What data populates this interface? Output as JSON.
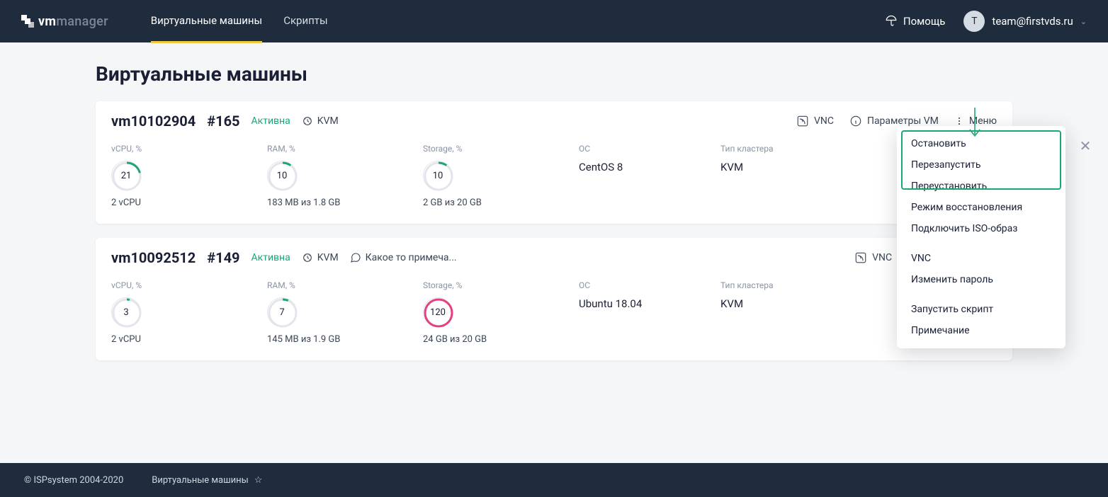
{
  "header": {
    "logo": {
      "prefix": "vm",
      "suffix": "manager"
    },
    "nav": {
      "vm": "Виртуальные машины",
      "scripts": "Скрипты"
    },
    "help": "Помощь",
    "user": {
      "initial": "T",
      "email": "team@firstvds.ru"
    }
  },
  "page": {
    "title": "Виртуальные машины"
  },
  "actions": {
    "vnc": "VNC",
    "params": "Параметры VM",
    "menu": "Меню"
  },
  "labels": {
    "vcpu": "vCPU, %",
    "ram": "RAM, %",
    "storage": "Storage, %",
    "os": "OC",
    "cluster": "Тип кластера"
  },
  "vms": [
    {
      "name": "vm10102904",
      "id": "#165",
      "status": "Активна",
      "hv": "KVM",
      "note": "",
      "vcpu": {
        "pct": "21",
        "sub": "2 vCPU"
      },
      "ram": {
        "pct": "10",
        "sub": "183 MB из 1.8 GB"
      },
      "storage": {
        "pct": "10",
        "sub": "2 GB из 20 GB",
        "hot": false
      },
      "os": "CentOS 8",
      "cluster": "KVM"
    },
    {
      "name": "vm10092512",
      "id": "#149",
      "status": "Активна",
      "hv": "KVM",
      "note": "Какое то примеча...",
      "vcpu": {
        "pct": "3",
        "sub": "2 vCPU"
      },
      "ram": {
        "pct": "7",
        "sub": "145 MB из 1.9 GB"
      },
      "storage": {
        "pct": "120",
        "sub": "24 GB из 20 GB",
        "hot": true
      },
      "os": "Ubuntu 18.04",
      "cluster": "KVM"
    }
  ],
  "menu": {
    "items": {
      "stop": "Остановить",
      "restart": "Перезапустить",
      "reinstall": "Переустановить",
      "rescue": "Режим восстановления",
      "iso": "Подключить ISO-образ",
      "vnc": "VNC",
      "passwd": "Изменить пароль",
      "script": "Запустить скрипт",
      "note": "Примечание"
    }
  },
  "footer": {
    "copyright": "© ISPsystem 2004-2020",
    "crumb": "Виртуальные машины"
  }
}
